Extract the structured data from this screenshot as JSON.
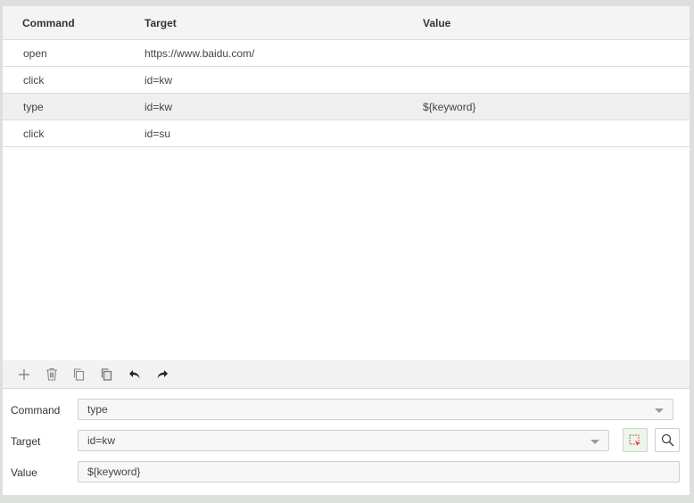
{
  "grid": {
    "headers": {
      "command": "Command",
      "target": "Target",
      "value": "Value"
    },
    "rows": [
      {
        "command": "open",
        "target": "https://www.baidu.com/",
        "value": ""
      },
      {
        "command": "click",
        "target": "id=kw",
        "value": ""
      },
      {
        "command": "type",
        "target": "id=kw",
        "value": "${keyword}"
      },
      {
        "command": "click",
        "target": "id=su",
        "value": ""
      }
    ],
    "selected_index": 2
  },
  "toolbar": {
    "icons": [
      "add-icon",
      "delete-icon",
      "copy-icon",
      "paste-icon",
      "undo-icon",
      "redo-icon"
    ]
  },
  "editor": {
    "command_label": "Command",
    "command_value": "type",
    "target_label": "Target",
    "target_value": "id=kw",
    "value_label": "Value",
    "value_value": "${keyword}"
  },
  "colors": {
    "select_button_bg": "#edf6ea",
    "select_icon_accent": "#d9534f"
  }
}
